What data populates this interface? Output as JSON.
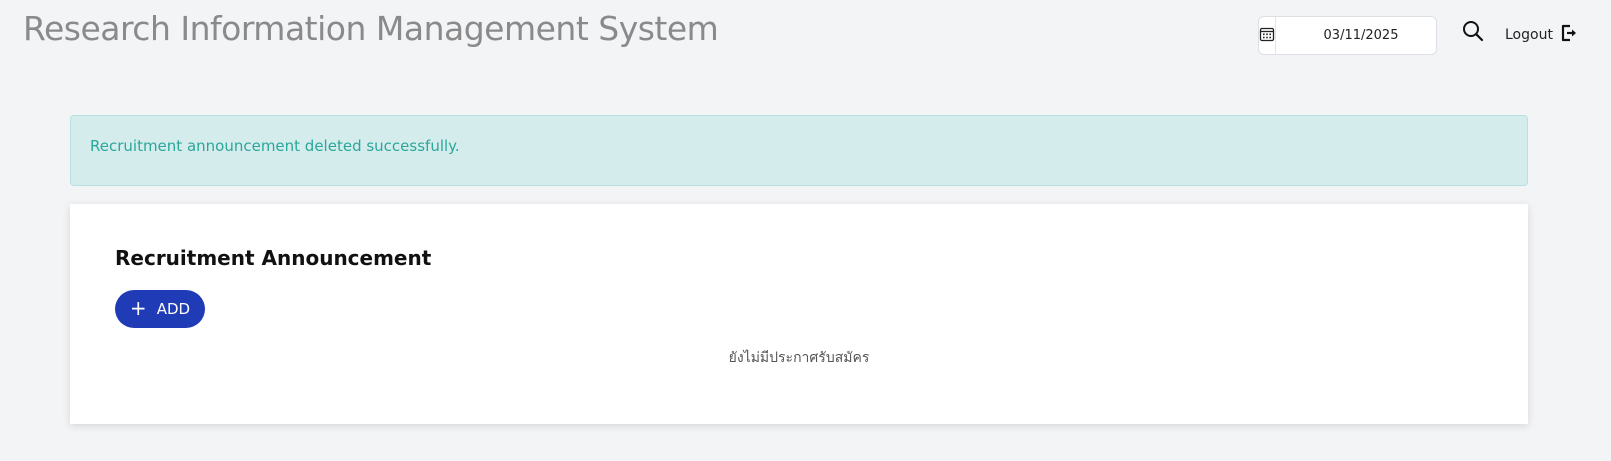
{
  "header": {
    "title": "Research Information Management System",
    "date_value": "03/11/2025",
    "logout_label": "Logout"
  },
  "alert": {
    "message": "Recruitment announcement deleted successfully."
  },
  "card": {
    "title": "Recruitment Announcement",
    "add_label": "ADD",
    "empty_message": "ยังไม่มีประกาศรับสมัคร"
  },
  "colors": {
    "primary_button": "#1f3bb5",
    "alert_background": "#d5eced",
    "alert_text": "#2aa79b",
    "page_background": "#f3f4f6"
  },
  "icons": {
    "date": "calendar-icon",
    "search": "search-icon",
    "logout": "logout-icon",
    "add": "plus-icon"
  }
}
